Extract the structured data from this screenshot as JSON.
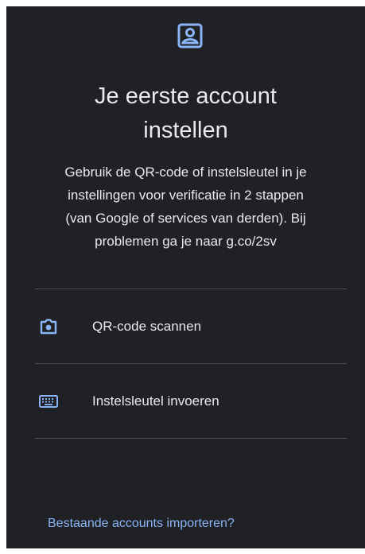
{
  "header": {
    "icon": "account-box-icon",
    "title_line1": "Je eerste account",
    "title_line2": "instellen"
  },
  "description": {
    "line1": "Gebruik de QR-code of instelsleutel in je",
    "line2": "instellingen voor verificatie in 2 stappen",
    "line3": "(van Google of services van derden). Bij",
    "line4": "problemen ga je naar g.co/2sv"
  },
  "options": [
    {
      "icon": "camera-icon",
      "label": "QR-code scannen"
    },
    {
      "icon": "keyboard-icon",
      "label": "Instelsleutel invoeren"
    }
  ],
  "footer": {
    "import_link": "Bestaande accounts importeren?"
  },
  "colors": {
    "background": "#202124",
    "text": "#e8eaed",
    "accent": "#8ab4f8",
    "divider": "#4a4d51"
  }
}
